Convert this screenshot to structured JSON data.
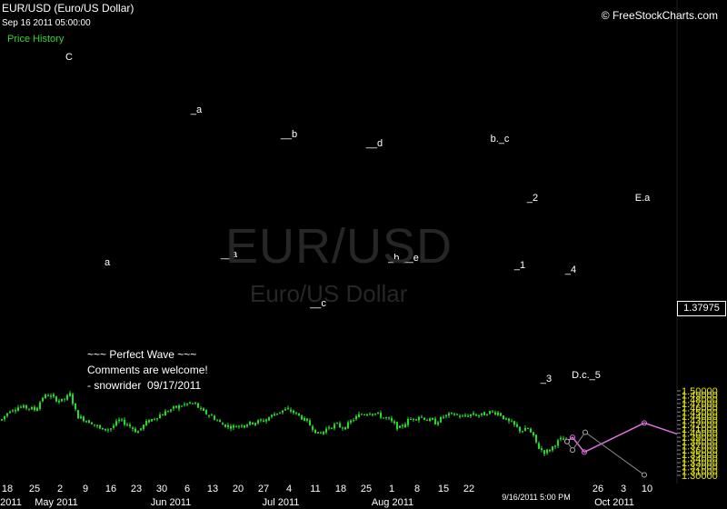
{
  "header": {
    "title": "EUR/USD (Euro/US Dollar)",
    "timestamp": "Sep 16 2011 05:00:00",
    "legend": "Price History",
    "copyright": "© FreeStockCharts.com"
  },
  "watermark": {
    "symbol": "EUR/USD",
    "name": "Euro/US Dollar"
  },
  "note": {
    "lines": [
      "~~~ Perfect Wave ~~~",
      "Comments are welcome!",
      "- snowrider  09/17/2011"
    ]
  },
  "colors": {
    "background": "#000000",
    "candle": "#22dd22",
    "projection_pink": "#e070e0",
    "projection_gray": "#8a8a8a",
    "axis_text": "#ffffff",
    "price_axis_text": "#e8e800",
    "grid": "#101010"
  },
  "chart_data": {
    "type": "candlestick",
    "symbol": "EUR/USD",
    "timeframe": "daily",
    "ylim": [
      1.3,
      1.505
    ],
    "y_ticks": [
      "1.30000",
      "1.31000",
      "1.32000",
      "1.33000",
      "1.34000",
      "1.35000",
      "1.36000",
      "1.37000",
      "1.38000",
      "1.39000",
      "1.40000",
      "1.41000",
      "1.42000",
      "1.43000",
      "1.44000",
      "1.45000",
      "1.46000",
      "1.47000",
      "1.48000",
      "1.49000",
      "1.50000"
    ],
    "x_day_ticks": [
      "18",
      "25",
      "2",
      "9",
      "16",
      "23",
      "30",
      "6",
      "13",
      "20",
      "27",
      "4",
      "11",
      "18",
      "25",
      "1",
      "8",
      "15",
      "22",
      "26",
      "3",
      "10"
    ],
    "x_month_ticks": [
      "2011",
      "May 2011",
      "Jun 2011",
      "Jul 2011",
      "Aug 2011",
      "Oct 2011"
    ],
    "x_date_readout": "9/16/2011 5:00 PM",
    "last_price": "1.37975",
    "ohlc_samples": [
      {
        "date": "Apr 18",
        "price": 1.43
      },
      {
        "date": "Apr 25",
        "price": 1.46
      },
      {
        "date": "May 2",
        "price": 1.48
      },
      {
        "date": "May 4",
        "price": 1.488
      },
      {
        "date": "May 9",
        "price": 1.44
      },
      {
        "date": "May 16",
        "price": 1.415
      },
      {
        "date": "May 23",
        "price": 1.405
      },
      {
        "date": "May 30",
        "price": 1.435
      },
      {
        "date": "Jun 6",
        "price": 1.465
      },
      {
        "date": "Jun 13",
        "price": 1.44
      },
      {
        "date": "Jun 20",
        "price": 1.415
      },
      {
        "date": "Jun 27",
        "price": 1.445
      },
      {
        "date": "Jul 4",
        "price": 1.45
      },
      {
        "date": "Jul 11",
        "price": 1.4
      },
      {
        "date": "Jul 18",
        "price": 1.42
      },
      {
        "date": "Jul 25",
        "price": 1.44
      },
      {
        "date": "Aug 1",
        "price": 1.43
      },
      {
        "date": "Aug 8",
        "price": 1.415
      },
      {
        "date": "Aug 15",
        "price": 1.44
      },
      {
        "date": "Aug 22",
        "price": 1.44
      },
      {
        "date": "Aug 29",
        "price": 1.45
      },
      {
        "date": "Sep 5",
        "price": 1.41
      },
      {
        "date": "Sep 9",
        "price": 1.365
      },
      {
        "date": "Sep 16",
        "price": 1.38
      }
    ],
    "wave_labels": [
      "C",
      "a",
      "_a",
      "__a",
      "__b",
      "__c",
      "__d",
      "_b.__e",
      "b._c",
      "_2",
      "_1",
      "_3",
      "_4",
      "D.c._5",
      "E.a"
    ],
    "projections": {
      "pink": [
        1.38,
        1.39,
        1.355,
        1.424,
        1.398
      ],
      "gray": [
        1.38,
        1.36,
        1.402,
        1.301
      ]
    },
    "grid": false,
    "legend_position": "top-left"
  }
}
